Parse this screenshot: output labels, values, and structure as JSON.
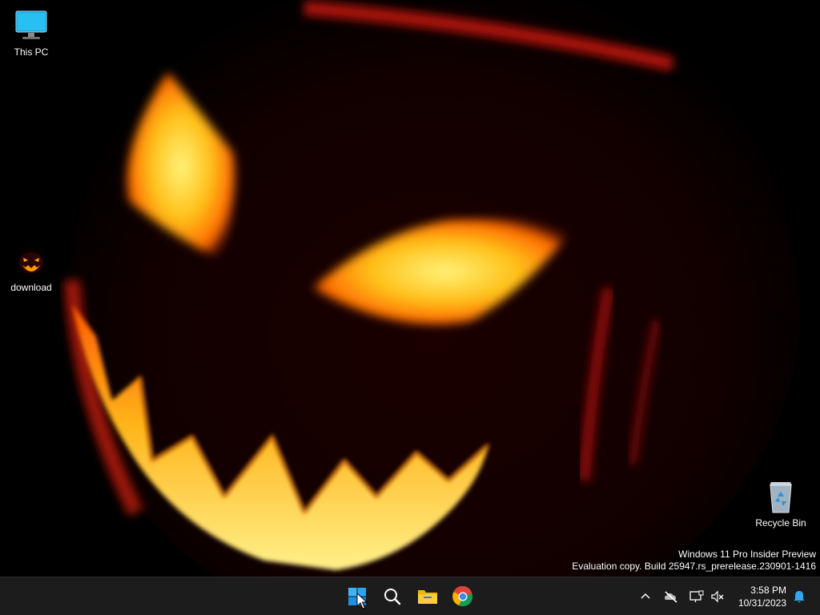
{
  "desktop": {
    "icons": [
      {
        "label": "This PC",
        "icon": "this-pc-icon"
      },
      {
        "label": "download",
        "icon": "pumpkin-image-icon"
      },
      {
        "label": "Recycle Bin",
        "icon": "recycle-bin-icon"
      }
    ],
    "watermark": {
      "line1": "Windows 11 Pro Insider Preview",
      "line2": "Evaluation copy. Build 25947.rs_prerelease.230901-1416"
    }
  },
  "taskbar": {
    "pinned": [
      {
        "name": "start-button",
        "icon": "windows-logo-icon"
      },
      {
        "name": "search-button",
        "icon": "search-icon"
      },
      {
        "name": "file-explorer-button",
        "icon": "folder-icon"
      },
      {
        "name": "chrome-button",
        "icon": "chrome-icon"
      }
    ],
    "tray": {
      "icons": [
        "chevron-up-icon",
        "network-offline-icon",
        "display-icon",
        "volume-muted-icon"
      ],
      "time": "3:58 PM",
      "date": "10/31/2023",
      "notification_icon": "bell-icon"
    }
  },
  "colors": {
    "taskbar_bg": "#1c1c1c",
    "accent": "#0078d4",
    "wallpaper_glow": "#ffb000"
  }
}
